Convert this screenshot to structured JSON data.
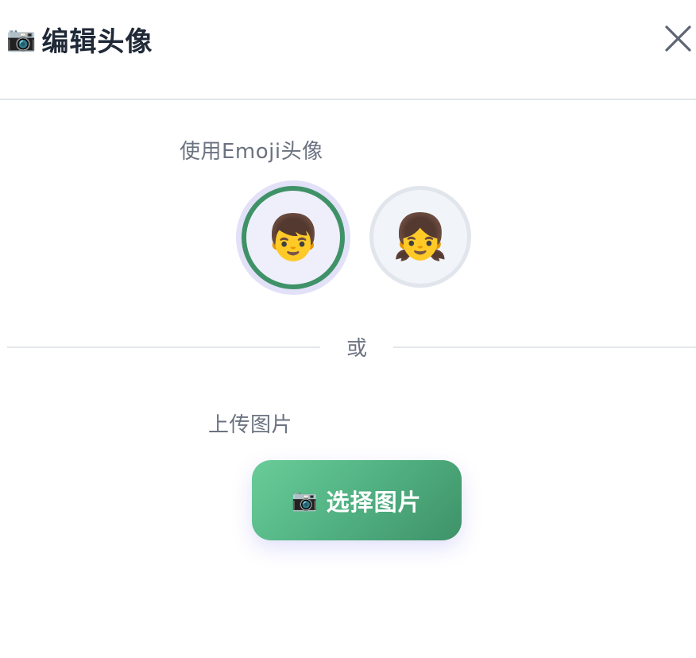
{
  "dialog": {
    "title_icon": "📷",
    "title": "编辑头像",
    "close_icon": "close-icon"
  },
  "emoji_section": {
    "label": "使用Emoji头像",
    "options": [
      {
        "emoji": "👦",
        "selected": true
      },
      {
        "emoji": "👧",
        "selected": false
      }
    ]
  },
  "divider": {
    "text": "或"
  },
  "upload_section": {
    "label": "上传图片",
    "button_icon": "📷",
    "button_label": "选择图片"
  },
  "colors": {
    "selected_border": "#3f9268",
    "button_gradient_start": "#69cd98",
    "button_gradient_end": "#3f9268",
    "title_text": "#1f2937",
    "muted_text": "#6b7280"
  }
}
